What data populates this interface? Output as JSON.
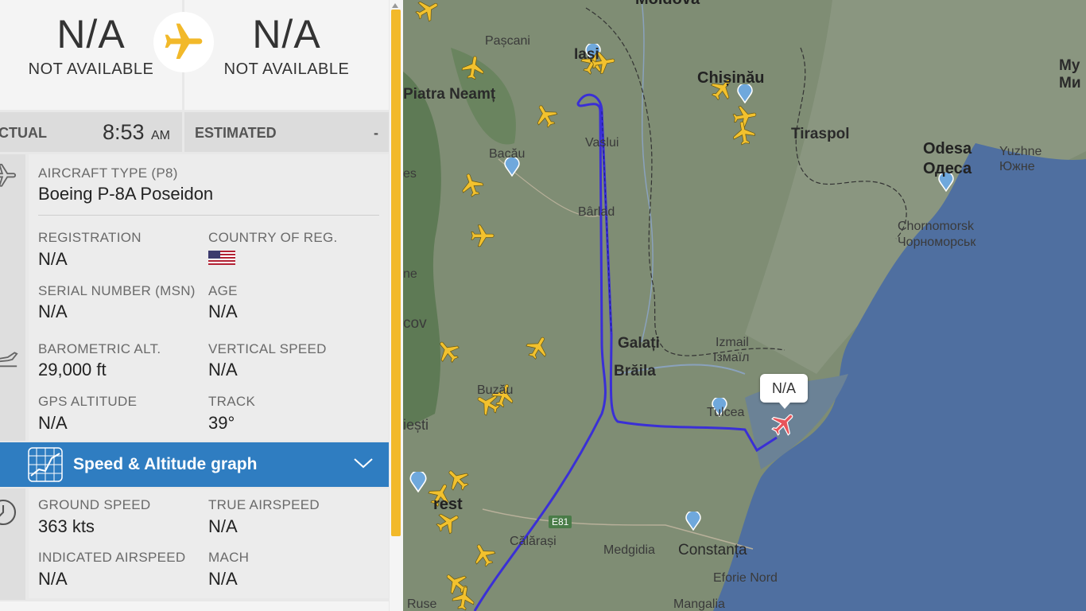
{
  "route": {
    "origin": {
      "code": "N/A",
      "name": "NOT AVAILABLE"
    },
    "destination": {
      "code": "N/A",
      "name": "NOT AVAILABLE"
    }
  },
  "times": {
    "actual_label": "CTUAL",
    "actual_time": "8:53",
    "actual_ampm": "AM",
    "estimated_label": "ESTIMATED",
    "estimated_value": "-"
  },
  "aircraft": {
    "type_label": "AIRCRAFT TYPE (P8)",
    "type_value": "Boeing P-8A Poseidon",
    "registration_label": "REGISTRATION",
    "registration_value": "N/A",
    "country_label": "COUNTRY OF REG.",
    "serial_label": "SERIAL NUMBER (MSN)",
    "serial_value": "N/A",
    "age_label": "AGE",
    "age_value": "N/A"
  },
  "altitude": {
    "baro_label": "BAROMETRIC ALT.",
    "baro_value": "29,000 ft",
    "vs_label": "VERTICAL SPEED",
    "vs_value": "N/A",
    "gps_label": "GPS ALTITUDE",
    "gps_value": "N/A",
    "track_label": "TRACK",
    "track_value": "39°"
  },
  "graph_bar": {
    "label": "Speed & Altitude graph"
  },
  "speed": {
    "gs_label": "GROUND SPEED",
    "gs_value": "363 kts",
    "tas_label": "TRUE AIRSPEED",
    "tas_value": "N/A",
    "ias_label": "INDICATED AIRSPEED",
    "ias_value": "N/A",
    "mach_label": "MACH",
    "mach_value": "N/A"
  },
  "map": {
    "callout": "N/A",
    "labels": {
      "moldova": "Moldova",
      "pascani": "Pașcani",
      "iasi": "Iași",
      "piatra": "Piatra Neamț",
      "chisinau": "Chișinău",
      "tiraspol": "Tiraspol",
      "bacau": "Bacău",
      "vaslui": "Vaslui",
      "birlad": "Bârlad",
      "odesa": "Odesa",
      "odesa_cyr": "Одеса",
      "yuzhne": "Yuzhne",
      "yuzhne_cyr": "Южне",
      "my": "Му",
      "my_cyr": "Ми",
      "chornomorsk": "Chornomorsk",
      "chornomorsk_cyr": "Чорноморськ",
      "galati": "Galați",
      "braila": "Brăila",
      "izmail": "Izmail",
      "izmail_cyr": "Ізмаїл",
      "tulcea": "Tulcea",
      "buzau": "Buzău",
      "iesti": "iești",
      "fragment_cov": "cov",
      "fragment_ne": "ne",
      "fragment_es": "es",
      "bucharest": "rest",
      "e81": "E81",
      "calarasi": "Călărași",
      "medgidia": "Medgidia",
      "constanta": "Constanța",
      "eforie": "Eforie Nord",
      "mangalia": "Mangalia",
      "ruse": "Ruse"
    }
  },
  "colors": {
    "accent_yellow": "#f2b92a",
    "graph_blue": "#2f7dc1",
    "track_blue": "#3a2fd6",
    "sea": "#4f6fa0",
    "land": "#7f8d74"
  }
}
